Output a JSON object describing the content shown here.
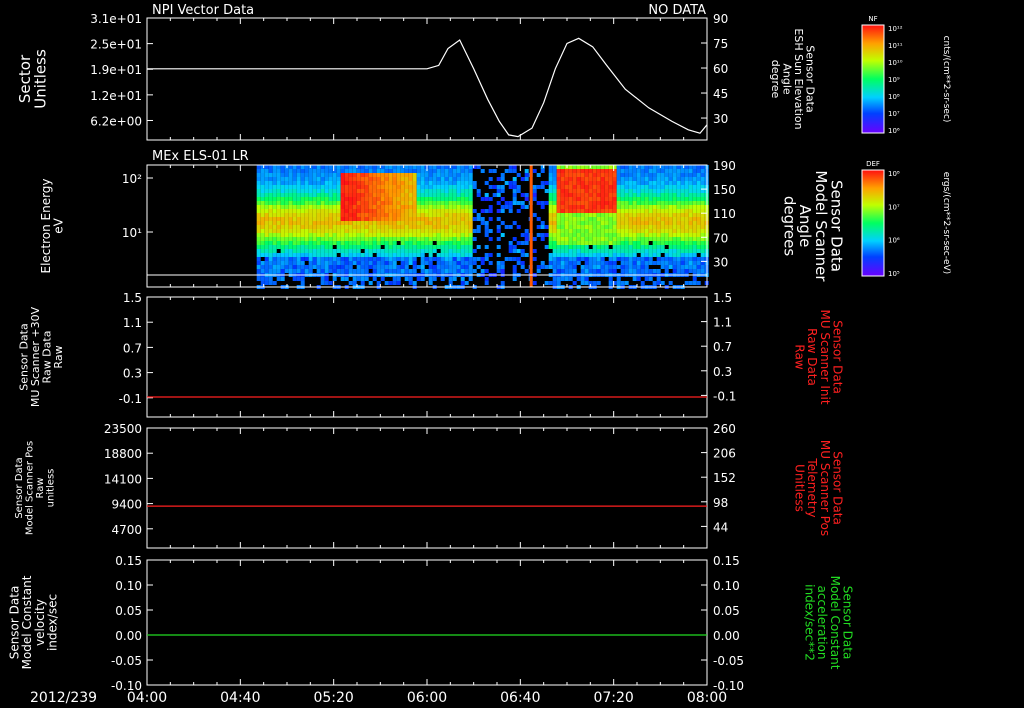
{
  "date_label": "2012/239",
  "time_ticks": [
    "04:00",
    "04:40",
    "05:20",
    "06:00",
    "06:40",
    "07:20",
    "08:00"
  ],
  "colors": {
    "bg": "#000000",
    "axis": "#ffffff",
    "red": "#ff2020",
    "green": "#22dd22"
  },
  "chart_data": [
    {
      "id": "p1",
      "type": "line",
      "title": "NPI Vector Data",
      "title_right": "NO DATA",
      "ylabel_left": [
        "Sector",
        "Unitless"
      ],
      "ylabel_right": [
        "Sensor Data",
        "ESH Sun Elevation",
        "Angle",
        "degree"
      ],
      "yticks_left": [
        "3.1e+01",
        "2.5e+01",
        "1.9e+01",
        "1.2e+01",
        "6.2e+00"
      ],
      "yticks_right": [
        "90",
        "75",
        "60",
        "45",
        "30"
      ],
      "ylim_right": [
        18,
        90
      ],
      "series": [
        {
          "axis": "right",
          "color": "#ffffff",
          "x": [
            "04:00",
            "06:00",
            "06:05",
            "06:09",
            "06:14",
            "06:20",
            "06:26",
            "06:31",
            "06:35",
            "06:39",
            "06:45",
            "06:50",
            "06:55",
            "07:00",
            "07:05",
            "07:11",
            "07:17",
            "07:25",
            "07:35",
            "07:45",
            "07:52",
            "07:57",
            "08:00"
          ],
          "y": [
            60,
            60,
            62,
            72,
            77,
            60,
            42,
            29,
            21,
            20,
            25,
            40,
            60,
            75,
            78,
            73,
            62,
            48,
            37,
            29,
            24,
            22,
            27
          ]
        }
      ],
      "colorbar": {
        "label": "NF",
        "unit": "cnts/(cm**2-sr-sec)",
        "ticks": [
          "10¹²",
          "10¹¹",
          "10¹⁰",
          "10⁹",
          "10⁸",
          "10⁷",
          "10⁶"
        ]
      }
    },
    {
      "id": "p2",
      "type": "heatmap",
      "title": "MEx ELS-01 LR",
      "ylabel_left": [
        "Electron Energy",
        "eV"
      ],
      "ylabel_right": [
        "Sensor Data",
        "Model Scanner",
        "Angle",
        "degrees"
      ],
      "yticks_left": [
        "10²",
        "10¹"
      ],
      "yticks_right": [
        "190",
        "150",
        "110",
        "70",
        "30"
      ],
      "colorbar": {
        "label": "DEF",
        "unit": "ergs/(cm**2-sr-sec-eV)",
        "ticks": [
          "10⁸",
          "10⁷",
          "10⁶",
          "10⁵"
        ]
      }
    },
    {
      "id": "p3",
      "type": "line",
      "ylabel_left": [
        "Sensor Data",
        "MU Scanner +30V",
        "Raw Data",
        "Raw"
      ],
      "ylabel_right": [
        "Sensor Data",
        "MU Scanner Init",
        "Raw Data",
        "Raw"
      ],
      "yticks_left": [
        "1.5",
        "1.1",
        "0.7",
        "0.3",
        "-0.1"
      ],
      "yticks_right": [
        "1.5",
        "1.1",
        "0.7",
        "0.3",
        "-0.1"
      ],
      "ylim": [
        -0.3,
        1.5
      ],
      "series": [
        {
          "color": "#ff2020",
          "x": [
            "04:00",
            "08:00"
          ],
          "y": [
            0.0,
            0.0
          ]
        }
      ]
    },
    {
      "id": "p4",
      "type": "line",
      "ylabel_left": [
        "Sensor Data",
        "Model Scanner Pos",
        "Raw",
        "unitless"
      ],
      "ylabel_right": [
        "Sensor Data",
        "MU Scanner Pos",
        "Telemetry",
        "Unitless"
      ],
      "yticks_left": [
        "23500",
        "18800",
        "14100",
        "9400",
        "4700"
      ],
      "yticks_right": [
        "260",
        "206",
        "152",
        "98",
        "44"
      ],
      "ylim": [
        0,
        23500
      ],
      "series": [
        {
          "color": "#ff2020",
          "x": [
            "04:00",
            "08:00"
          ],
          "y": [
            8200,
            8200
          ]
        }
      ]
    },
    {
      "id": "p5",
      "type": "line",
      "ylabel_left": [
        "Sensor Data",
        "Model Constant",
        "velocity",
        "index/sec"
      ],
      "ylabel_right": [
        "Sensor Data",
        "Model Constant",
        "acceleration",
        "index/sec**2"
      ],
      "yticks_left": [
        "0.15",
        "0.10",
        "0.05",
        "0.00",
        "-0.05",
        "-0.10"
      ],
      "yticks_right": [
        "0.15",
        "0.10",
        "0.05",
        "0.00",
        "-0.05",
        "-0.10"
      ],
      "ylim": [
        -0.1,
        0.15
      ],
      "series": [
        {
          "color": "#22dd22",
          "x": [
            "04:00",
            "08:00"
          ],
          "y": [
            0.0,
            0.0
          ]
        }
      ]
    }
  ]
}
